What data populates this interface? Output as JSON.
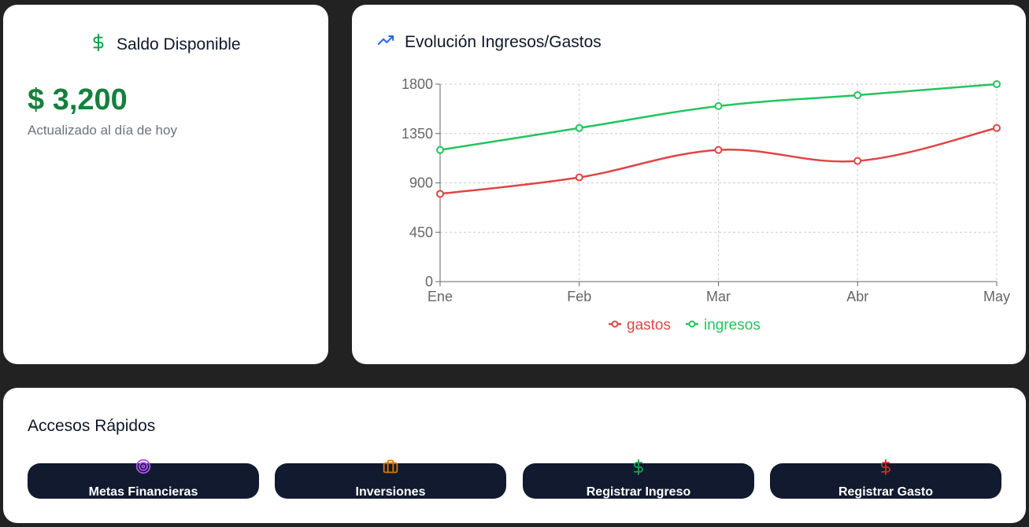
{
  "balance": {
    "title": "Saldo Disponible",
    "amount": "$ 3,200",
    "subtitle": "Actualizado al día de hoy",
    "icon": "dollar-icon"
  },
  "chart_card": {
    "title": "Evolución Ingresos/Gastos",
    "icon": "trending-up-icon"
  },
  "chart_data": {
    "type": "line",
    "categories": [
      "Ene",
      "Feb",
      "Mar",
      "Abr",
      "May"
    ],
    "series": [
      {
        "name": "gastos",
        "values": [
          800,
          950,
          1200,
          1100,
          1400
        ],
        "color": "#e04545"
      },
      {
        "name": "ingresos",
        "values": [
          1200,
          1400,
          1600,
          1700,
          1800
        ],
        "color": "#22c55e"
      }
    ],
    "ylim": [
      0,
      1800
    ],
    "yticks": [
      0,
      450,
      900,
      1350,
      1800
    ],
    "grid": true,
    "legend": "bottom-center"
  },
  "quick_access": {
    "title": "Accesos Rápidos",
    "buttons": [
      {
        "label": "Metas Financieras",
        "icon": "target-icon",
        "color": "#a855f7"
      },
      {
        "label": "Inversiones",
        "icon": "briefcase-icon",
        "color": "#d97706"
      },
      {
        "label": "Registrar Ingreso",
        "icon": "dollar-icon",
        "color": "#16a34a"
      },
      {
        "label": "Registrar Gasto",
        "icon": "dollar-icon",
        "color": "#dc2626"
      }
    ]
  },
  "colors": {
    "background": "#222222",
    "card": "#ffffff",
    "button": "#111a2e",
    "accent_green": "#15803d",
    "accent_blue": "#2563eb"
  }
}
